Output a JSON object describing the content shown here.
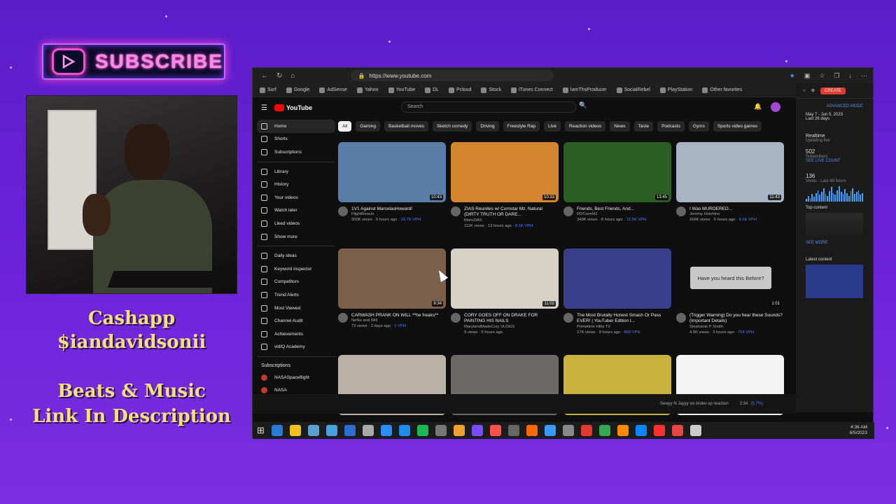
{
  "overlay": {
    "subscribe_label": "SUBSCRIBE",
    "cashapp_label": "Cashapp",
    "cashapp_handle": "$iandavidsonii",
    "beats_line1": "Beats & Music",
    "beats_line2": "Link In Description"
  },
  "browser": {
    "url": "https://www.youtube.com",
    "favorites": [
      "Surf",
      "Google",
      "AdSense",
      "Yahoo",
      "YouTube",
      "DL",
      "Pcloud",
      "Stock",
      "iTunes Connect",
      "IamThsProducer",
      "SocialRebel",
      "PlayStation",
      "Other favorites"
    ]
  },
  "youtube": {
    "logo": "YouTube",
    "search_placeholder": "Search",
    "chips": [
      "All",
      "Gaming",
      "Basketball moves",
      "Sketch comedy",
      "Driving",
      "Freestyle Rap",
      "Live",
      "Reaction videos",
      "News",
      "Taste",
      "Podcasts",
      "Gyms",
      "Sports video games"
    ],
    "sidebar": [
      "Home",
      "Shorts",
      "Subscriptions",
      "Library",
      "History",
      "Your videos",
      "Watch later",
      "Liked videos",
      "Show more",
      "Daily ideas",
      "Keyword inspector",
      "Competitors",
      "Trend Alerts",
      "Most Viewed",
      "Channel Audit",
      "Achievements",
      "vidIQ Academy"
    ],
    "subscriptions_title": "Subscriptions",
    "subscriptions": [
      "NASASpaceflight",
      "NASA"
    ],
    "videos": [
      {
        "title": "1V1 Against MarcelasHoward!",
        "channel": "FlightReacts",
        "views": "300K views · 9 hours ago",
        "vph": "· 33.7K VPH",
        "duration": "10:43",
        "thumb": "#5b7ea8"
      },
      {
        "title": "ZIAS Reunites w/ Cornstar Mz. Natural (DIRTY TRUTH OR DARE...",
        "channel": "More2IAS",
        "views": "111K views · 13 hours ago",
        "vph": "· 8.1K VPH",
        "duration": "10:33",
        "thumb": "#d4862f"
      },
      {
        "title": "Friends, Best Friends, And...",
        "channel": "RDCworld1",
        "views": "349K views · 8 hours ago",
        "vph": "· 12.5K VPH",
        "duration": "13:45",
        "thumb": "#2a5e22"
      },
      {
        "title": "I Was MURDERED...",
        "channel": "Jeremy Hutchins",
        "views": "266K views · 6 hours ago",
        "vph": "· 8.5K VPH",
        "duration": "11:43",
        "thumb": "#a8b4c4"
      },
      {
        "title": "CARWASH PRANK ON WILL **he freaks**",
        "channel": "NeNe and Will",
        "views": "73 views · 2 days ago",
        "vph": "· 1 VPH",
        "duration": "8:34",
        "thumb": "#7a5f4a"
      },
      {
        "title": "CORY GOES OFF ON DRAKE FOR PAINTING HIS NAILS",
        "channel": "MarylandMadeCory VLOGS",
        "views": "9 views · 5 hours ago",
        "vph": "",
        "duration": "11:02",
        "thumb": "#d8d2c6"
      },
      {
        "title": "The Most Brutally Honest Smash Or Pass EVER! | YouTuber Edition I...",
        "channel": "Primetime Hitla TV",
        "views": "27K views · 9 hours ago",
        "vph": "· 860 VPH",
        "duration": "",
        "thumb": "#3a3f8c"
      },
      {
        "title": "(Trigger Warning) Do you hear these Sounds? (Important Details)",
        "channel": "Stephanie P Smith",
        "views": "4.5K views · 3 hours ago",
        "vph": "· 764 VPH",
        "duration": "1:01",
        "thumb": "#0f0f0f"
      },
      {
        "title": "",
        "channel": "",
        "views": "",
        "vph": "",
        "duration": "",
        "thumb": "#b9b0a6"
      },
      {
        "title": "",
        "channel": "",
        "views": "",
        "vph": "",
        "duration": "",
        "thumb": "#6c6a66"
      },
      {
        "title": "",
        "channel": "",
        "views": "",
        "vph": "",
        "duration": "",
        "thumb": "#c9b23e"
      },
      {
        "title": "",
        "channel": "",
        "views": "",
        "vph": "",
        "duration": "",
        "thumb": "#f4f4f4"
      }
    ],
    "preview_bubble": "Have you heard this Before?"
  },
  "vidiq_panel": {
    "create_label": "CREATE",
    "advanced_mode": "ADVANCED MODE",
    "date_range": "May 7 - Jun 5, 2023",
    "last_days": "Last 28 days",
    "realtime_label": "Realtime",
    "realtime_sub": "Updating live",
    "subscribers_value": "502",
    "subscribers_label": "Subscribers",
    "see_live_count": "SEE LIVE COUNT",
    "views_value": "136",
    "views_label": "Views · Last 48 hours",
    "top_content": "Top content",
    "see_more": "SEE MORE",
    "latest_content": "Latest content",
    "bars": [
      3,
      6,
      4,
      8,
      5,
      9,
      12,
      7,
      10,
      14,
      8,
      6,
      11,
      15,
      9,
      7,
      12,
      16,
      10,
      8,
      13,
      9,
      6,
      11,
      14,
      8,
      10,
      12,
      7,
      9
    ]
  },
  "player": {
    "now_playing": "Swayy N Jayyy ws broke up reaction",
    "time": "2:34",
    "vph": "(5.7%)"
  },
  "taskbar": {
    "time": "4:36 AM",
    "date": "6/5/2023",
    "apps": [
      "#2b7bd6",
      "#f0c020",
      "#5aa0d0",
      "#4aa0e0",
      "#2c6fd0",
      "#aaaaaa",
      "#2a8cff",
      "#1d8cf0",
      "#1db954",
      "#777777",
      "#f0a030",
      "#7a4cff",
      "#ff5050",
      "#666666",
      "#ff6a00",
      "#3a9aff",
      "#888888",
      "#e23a2e",
      "#34a853",
      "#ff8c00",
      "#0a84ff",
      "#ff3030",
      "#e84444",
      "#cccccc"
    ]
  }
}
